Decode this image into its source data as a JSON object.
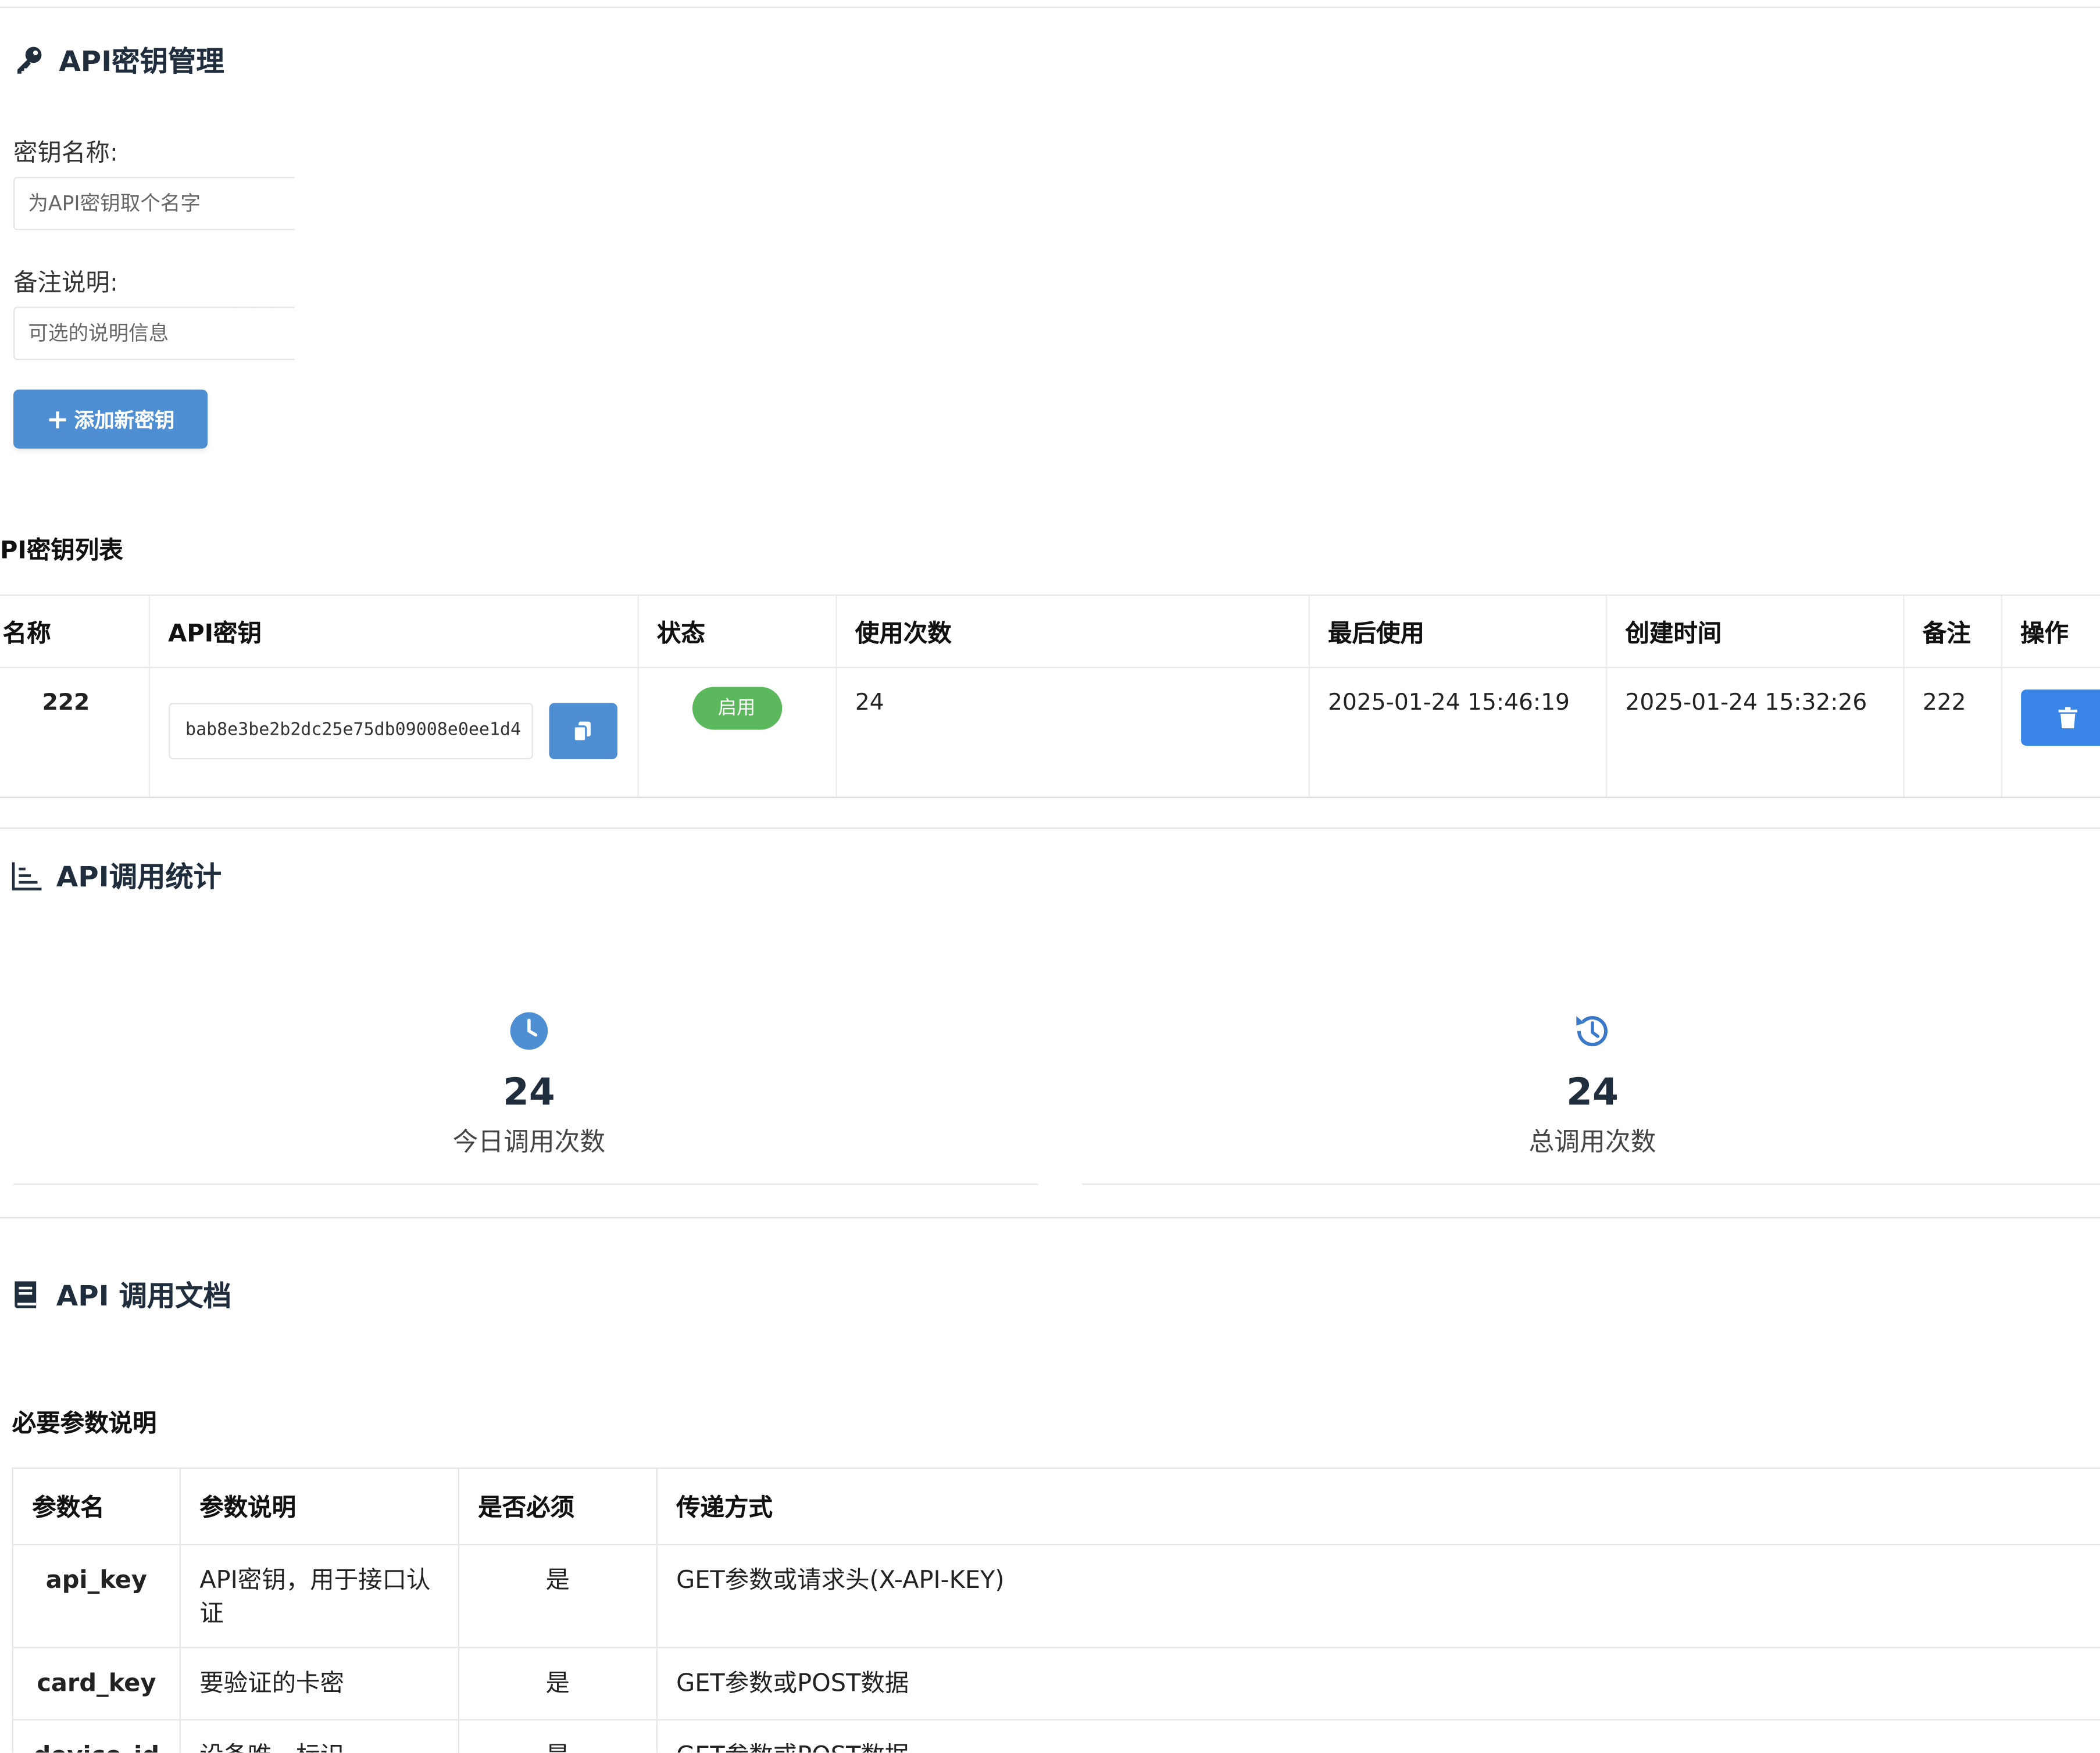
{
  "key_section": {
    "title": "API密钥管理",
    "icon": "key-icon",
    "name_label": "密钥名称:",
    "name_placeholder": "为API密钥取个名字",
    "note_label": "备注说明:",
    "note_placeholder": "可选的说明信息",
    "add_button": "添加新密钥",
    "accent_color": "#4e8fd4"
  },
  "key_list": {
    "title": "PI密钥列表",
    "headers": [
      "名称",
      "API密钥",
      "状态",
      "使用次数",
      "最后使用",
      "创建时间",
      "备注",
      "操作"
    ],
    "rows": [
      {
        "name": "222",
        "key": "bab8e3be2b2dc25e75db09008e0ee1d4",
        "status": "启用",
        "usage": "24",
        "last_used": "2025-01-24 15:46:19",
        "created": "2025-01-24 15:32:26",
        "note": "222"
      }
    ],
    "status_color": "#5cb85c",
    "delete_color": "#3a86e8"
  },
  "stats_section": {
    "title": "API调用统计",
    "icon": "bar-chart-icon",
    "today": {
      "value": "24",
      "label": "今日调用次数",
      "icon": "clock-icon"
    },
    "total": {
      "value": "24",
      "label": "总调用次数",
      "icon": "history-icon"
    }
  },
  "docs_section": {
    "title": "API 调用文档",
    "icon": "book-icon",
    "params_title": "必要参数说明",
    "headers": [
      "参数名",
      "参数说明",
      "是否必须",
      "传递方式"
    ],
    "rows": [
      {
        "name": "api_key",
        "desc": "API密钥，用于接口认证",
        "required": "是",
        "method": "GET参数或请求头(X-API-KEY)"
      },
      {
        "name": "card_key",
        "desc": "要验证的卡密",
        "required": "是",
        "method": "GET参数或POST数据"
      },
      {
        "name": "device_id",
        "desc": "设备唯一标识",
        "required": "是",
        "method": "GET参数或POST数据"
      }
    ]
  }
}
